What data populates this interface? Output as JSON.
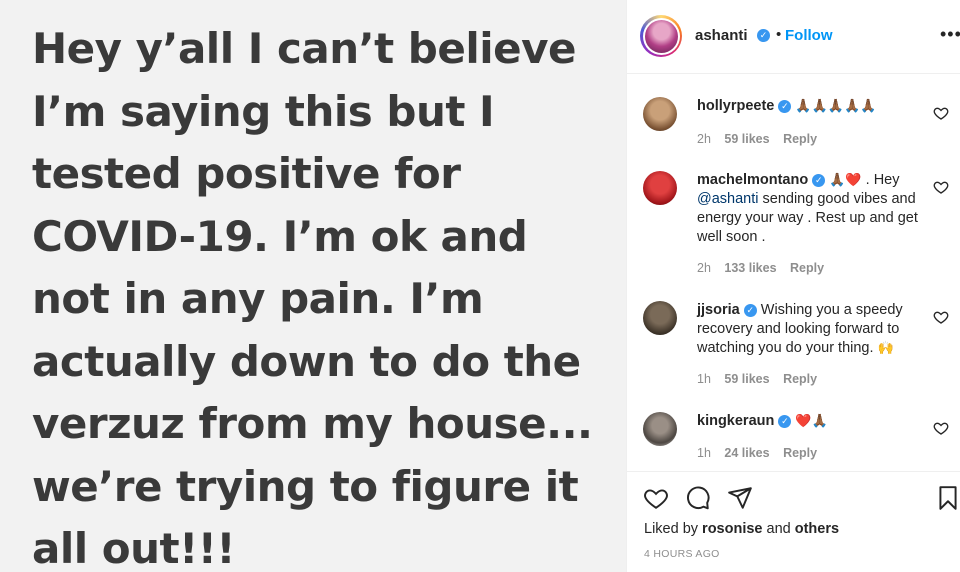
{
  "post": {
    "text": "Hey y’all I can’t believe\nI’m saying this but I\ntested positive for\nCOVID-19.  I’m ok and\nnot in any pain. I’m\nactually down to do the\nverzuz from my house...\nwe’re trying to figure it\nall out!!!"
  },
  "header": {
    "username": "ashanti",
    "dot": "•",
    "follow_label": "Follow",
    "more_label": "•••"
  },
  "comments": [
    {
      "username": "hollyrpeete",
      "verified": true,
      "emoji": "🙏🏾🙏🏾🙏🏾🙏🏾🙏🏾",
      "text": "",
      "time": "2h",
      "likes": "59 likes",
      "reply": "Reply"
    },
    {
      "username": "machelmontano",
      "verified": true,
      "emoji": "🙏🏾❤️",
      "text_before": " . Hey ",
      "mention": "@ashanti",
      "text": " sending good vibes and energy your way . Rest up and get well soon .",
      "time": "2h",
      "likes": "133 likes",
      "reply": "Reply"
    },
    {
      "username": "jjsoria",
      "verified": true,
      "text": " Wishing you a speedy recovery and looking forward to watching you do your thing. ",
      "emoji": "🙌",
      "time": "1h",
      "likes": "59 likes",
      "reply": "Reply"
    },
    {
      "username": "kingkeraun",
      "verified": true,
      "emoji": "❤️🙏🏾",
      "text": "",
      "time": "1h",
      "likes": "24 likes",
      "reply": "Reply"
    }
  ],
  "footer": {
    "liked_by_prefix": "Liked by ",
    "liked_by_user": "rosonise",
    "liked_by_and": " and ",
    "liked_by_others": "others",
    "timestamp": "4 HOURS AGO"
  },
  "colors": {
    "accent": "#0095f6",
    "verified": "#3897f0",
    "muted": "#8e8e8e",
    "text": "#262626",
    "post_bg": "#f2f2f2"
  },
  "icons": [
    "verified-badge-icon",
    "heart-icon",
    "comment-icon",
    "share-icon",
    "bookmark-icon",
    "more-icon"
  ]
}
